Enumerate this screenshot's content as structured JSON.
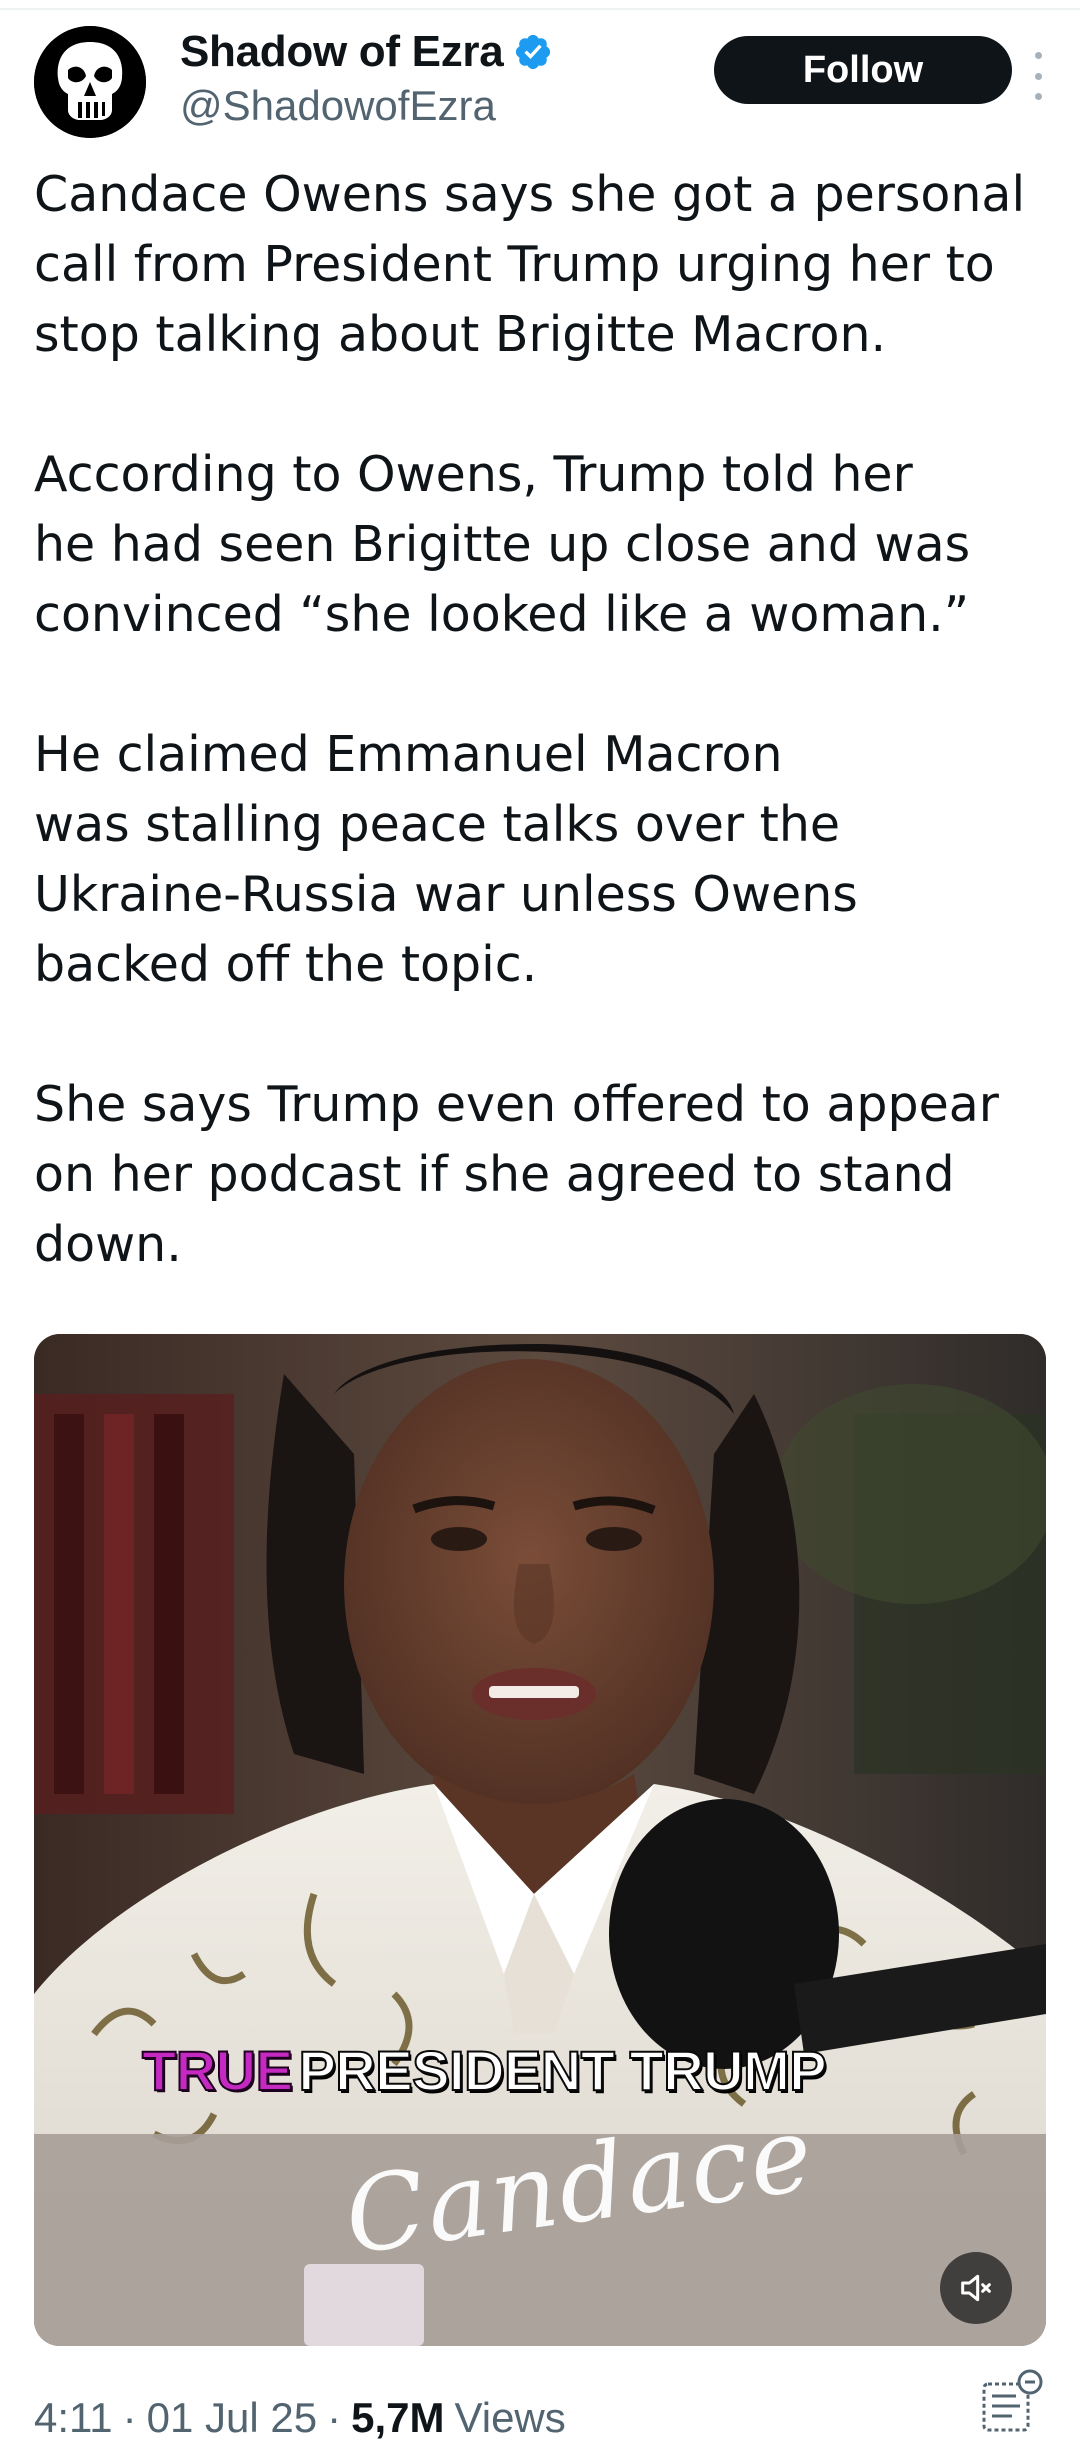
{
  "author": {
    "display_name": "Shadow of Ezra",
    "handle": "@ShadowofEzra",
    "verified": true,
    "avatar_icon": "skull-icon"
  },
  "actions": {
    "follow_label": "Follow",
    "more_icon": "more-vertical-icon"
  },
  "tweet": {
    "paragraphs": [
      [
        "Candace Owens says she got a personal",
        "call from President Trump urging her to",
        "stop talking about Brigitte Macron."
      ],
      [
        "According to Owens, Trump told her",
        "he had seen Brigitte up close and was",
        "convinced “she looked like a woman.”"
      ],
      [
        "He claimed Emmanuel Macron",
        "was stalling peace talks over the",
        "Ukraine-Russia war unless Owens",
        "backed off the topic."
      ],
      [
        "She says Trump even offered to appear",
        "on her podcast if she agreed to stand",
        "down."
      ]
    ]
  },
  "media": {
    "type": "video",
    "caption_highlight": "TRUE",
    "caption_main": "PRESIDENT TRUMP",
    "signature_text": "Candace",
    "mute_icon": "speaker-muted-icon"
  },
  "meta": {
    "time": "4:11",
    "date": "01 Jul 25",
    "separator": "·",
    "views_count": "5,7M",
    "views_label": "Views",
    "analytics_icon": "post-analytics-icon"
  },
  "colors": {
    "text_primary": "#0f1419",
    "text_secondary": "#536471",
    "verified_blue": "#1d9bf0",
    "follow_bg": "#0f1419",
    "caption_highlight": "#c42ac2"
  }
}
